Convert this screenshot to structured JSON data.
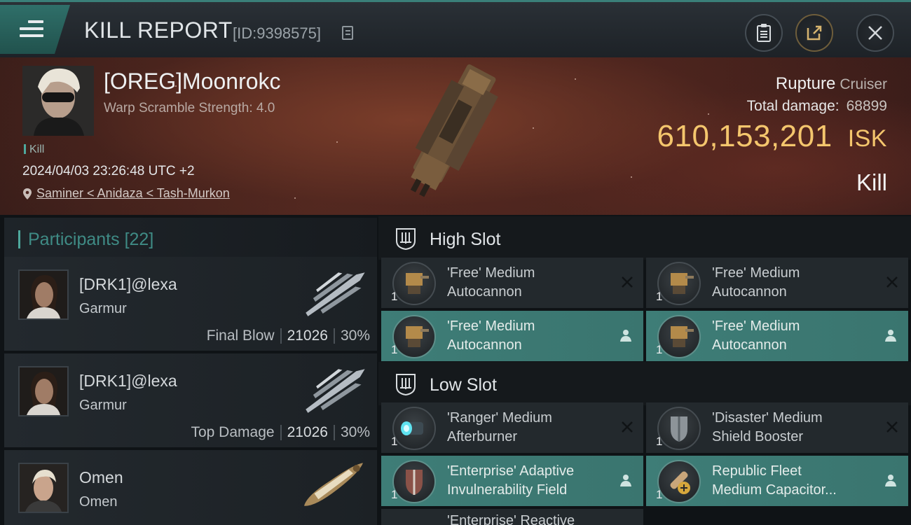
{
  "header": {
    "title": "KILL REPORT",
    "report_id": "[ID:9398575]"
  },
  "victim": {
    "name": "[OREG]Moonrokc",
    "warp_scramble": "Warp Scramble Strength: 4.0",
    "tag": "Kill",
    "timestamp": "2024/04/03 23:26:48 UTC +2",
    "location": "Saminer < Anidaza < Tash-Murkon",
    "ship_name": "Rupture",
    "ship_class": "Cruiser",
    "total_damage_label": "Total damage:",
    "total_damage": "68899",
    "isk_value": "610,153,201",
    "isk_unit": "ISK",
    "result": "Kill"
  },
  "participants": {
    "label": "Participants",
    "count": "[22]",
    "items": [
      {
        "name": "[DRK1]@lexa",
        "ship": "Garmur",
        "role": "Final Blow",
        "damage": "21026",
        "percent": "30%"
      },
      {
        "name": "[DRK1]@lexa",
        "ship": "Garmur",
        "role": "Top Damage",
        "damage": "21026",
        "percent": "30%"
      },
      {
        "name": "Omen",
        "ship": "Omen",
        "role": "",
        "damage": "",
        "percent": ""
      }
    ]
  },
  "fitting": {
    "high_slot_label": "High Slot",
    "low_slot_label": "Low Slot",
    "high": [
      {
        "qty": "1",
        "line1": "'Free' Medium",
        "line2": "Autocannon",
        "state": "destroyed"
      },
      {
        "qty": "1",
        "line1": "'Free' Medium",
        "line2": "Autocannon",
        "state": "destroyed"
      },
      {
        "qty": "1",
        "line1": "'Free' Medium",
        "line2": "Autocannon",
        "state": "dropped"
      },
      {
        "qty": "1",
        "line1": "'Free' Medium",
        "line2": "Autocannon",
        "state": "dropped"
      }
    ],
    "low": [
      {
        "qty": "1",
        "line1": "'Ranger' Medium",
        "line2": "Afterburner",
        "state": "destroyed"
      },
      {
        "qty": "1",
        "line1": "'Disaster' Medium",
        "line2": "Shield Booster",
        "state": "destroyed"
      },
      {
        "qty": "1",
        "line1": "'Enterprise' Adaptive",
        "line2": "Invulnerability Field",
        "state": "dropped"
      },
      {
        "qty": "1",
        "line1": "Republic Fleet",
        "line2": "Medium Capacitor...",
        "state": "dropped"
      }
    ],
    "partial": "'Enterprise' Reactive"
  },
  "colors": {
    "accent_teal": "#3e7d77",
    "isk_gold": "#f4c66d"
  }
}
